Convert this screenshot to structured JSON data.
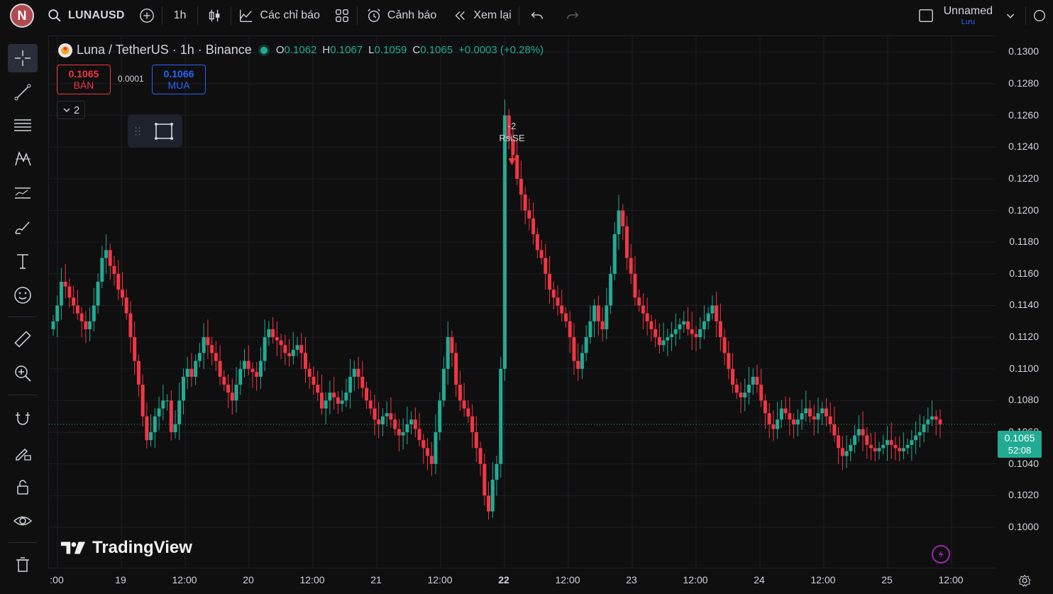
{
  "topbar": {
    "avatar_letter": "N",
    "symbol": "LUNAUSD",
    "interval": "1h",
    "indicators_label": "Các chỉ báo",
    "alerts_label": "Cảnh báo",
    "replay_label": "Xem lại",
    "layout_name": "Unnamed",
    "save_label": "Lưu"
  },
  "legend": {
    "title": "Luna / TetherUS · 1h · Binance",
    "o_key": "O",
    "o_val": "0.1062",
    "h_key": "H",
    "h_val": "0.1067",
    "l_key": "L",
    "l_val": "0.1059",
    "c_key": "C",
    "c_val": "0.1065",
    "change": "+0.0003 (+0.28%)"
  },
  "trade": {
    "sell_price": "0.1065",
    "sell_label": "BÁN",
    "spread": "0.0001",
    "buy_price": "0.1066",
    "buy_label": "MUA"
  },
  "collapse_count": "2",
  "signal": {
    "count": "-2",
    "name": "RsiSE"
  },
  "watermark": "TradingView",
  "price_label": {
    "price": "0.1065",
    "countdown": "52:08"
  },
  "colors": {
    "up": "#22ab94",
    "down": "#f23645",
    "accent": "#2962ff",
    "bg": "#0f0f0f"
  },
  "chart_data": {
    "type": "candlestick",
    "y_ticks": [
      "0.1300",
      "0.1280",
      "0.1260",
      "0.1240",
      "0.1220",
      "0.1200",
      "0.1180",
      "0.1160",
      "0.1140",
      "0.1120",
      "0.1100",
      "0.1080",
      "0.1060",
      "0.1040",
      "0.1020",
      "0.1000"
    ],
    "ylim": [
      0.0974,
      0.131
    ],
    "x_ticks": [
      ":00",
      "19",
      "12:00",
      "20",
      "12:00",
      "21",
      "12:00",
      "22",
      "12:00",
      "23",
      "12:00",
      "24",
      "12:00",
      "25",
      "12:00"
    ],
    "current_price": 0.1065,
    "closes": [
      0.113,
      0.114,
      0.1155,
      0.1152,
      0.1145,
      0.114,
      0.1135,
      0.113,
      0.1125,
      0.113,
      0.114,
      0.1155,
      0.117,
      0.1175,
      0.1165,
      0.116,
      0.115,
      0.1145,
      0.1135,
      0.112,
      0.1105,
      0.109,
      0.107,
      0.1055,
      0.106,
      0.107,
      0.1075,
      0.108,
      0.108,
      0.106,
      0.1065,
      0.108,
      0.1095,
      0.11,
      0.1095,
      0.1105,
      0.111,
      0.112,
      0.1115,
      0.111,
      0.1105,
      0.1095,
      0.109,
      0.1085,
      0.108,
      0.109,
      0.11,
      0.1105,
      0.11,
      0.1098,
      0.1095,
      0.1105,
      0.112,
      0.1125,
      0.112,
      0.1118,
      0.1115,
      0.111,
      0.1108,
      0.1112,
      0.1115,
      0.111,
      0.11,
      0.1095,
      0.109,
      0.1085,
      0.1075,
      0.108,
      0.1085,
      0.1082,
      0.1078,
      0.108,
      0.1085,
      0.1095,
      0.11,
      0.1095,
      0.1088,
      0.108,
      0.1075,
      0.1068,
      0.1065,
      0.107,
      0.1072,
      0.1068,
      0.1062,
      0.1058,
      0.106,
      0.1065,
      0.1068,
      0.1062,
      0.1055,
      0.105,
      0.1045,
      0.104,
      0.106,
      0.108,
      0.11,
      0.112,
      0.111,
      0.109,
      0.108,
      0.1075,
      0.107,
      0.106,
      0.105,
      0.104,
      0.102,
      0.101,
      0.103,
      0.104,
      0.11,
      0.126,
      0.1245,
      0.1235,
      0.122,
      0.121,
      0.12,
      0.1195,
      0.1185,
      0.1175,
      0.117,
      0.116,
      0.115,
      0.1145,
      0.114,
      0.1135,
      0.113,
      0.112,
      0.1105,
      0.11,
      0.111,
      0.112,
      0.113,
      0.114,
      0.113,
      0.1125,
      0.114,
      0.116,
      0.1185,
      0.12,
      0.119,
      0.117,
      0.116,
      0.1145,
      0.114,
      0.1135,
      0.113,
      0.1125,
      0.112,
      0.1115,
      0.1118,
      0.112,
      0.1122,
      0.1125,
      0.1128,
      0.113,
      0.1125,
      0.1122,
      0.112,
      0.1125,
      0.113,
      0.1135,
      0.114,
      0.113,
      0.112,
      0.111,
      0.11,
      0.109,
      0.1085,
      0.1082,
      0.1085,
      0.109,
      0.1095,
      0.109,
      0.108,
      0.1072,
      0.1065,
      0.1062,
      0.1068,
      0.1075,
      0.1072,
      0.1068,
      0.1065,
      0.1068,
      0.1072,
      0.1075,
      0.107,
      0.1068,
      0.1072,
      0.1075,
      0.107,
      0.1065,
      0.1058,
      0.105,
      0.1045,
      0.1048,
      0.1052,
      0.1058,
      0.1062,
      0.1058,
      0.1052,
      0.105,
      0.1048,
      0.105,
      0.1052,
      0.1055,
      0.1052,
      0.105,
      0.1048,
      0.105,
      0.1052,
      0.1055,
      0.1058,
      0.106,
      0.1065,
      0.1068,
      0.107,
      0.1068,
      0.1065
    ]
  }
}
